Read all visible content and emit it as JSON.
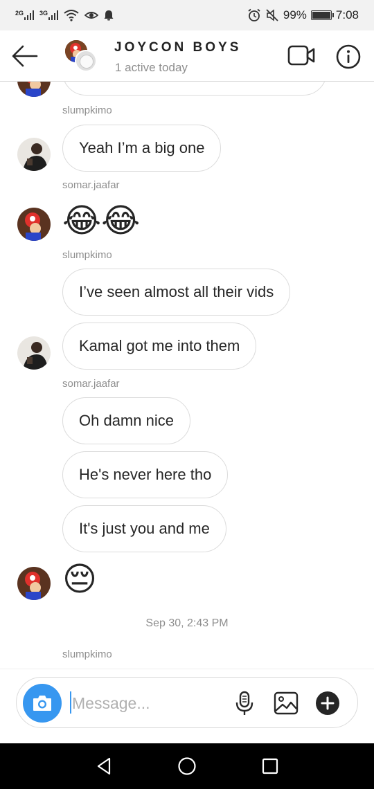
{
  "status_bar": {
    "network_1": "2G",
    "network_2": "3G",
    "battery_text": "99%",
    "battery_level": 0.99,
    "time": "7:08",
    "icons": [
      "signal-icon",
      "wifi-icon",
      "eye-icon",
      "notification-icon",
      "alarm-icon",
      "mute-icon",
      "battery-icon"
    ]
  },
  "header": {
    "title": "JOYCON BOYS",
    "subtitle": "1 active today",
    "icons": [
      "back-arrow-icon",
      "video-call-icon",
      "info-icon"
    ]
  },
  "messages": [
    {
      "type": "username",
      "text": "slumpkimo"
    },
    {
      "type": "text",
      "text": "Yeah I’m a big one"
    },
    {
      "type": "username",
      "text": "somar.jaafar"
    },
    {
      "type": "emoji",
      "text": "😂😂"
    },
    {
      "type": "username",
      "text": "slumpkimo"
    },
    {
      "type": "text",
      "text": "I’ve seen almost all their vids"
    },
    {
      "type": "text",
      "text": "Kamal got me into them"
    },
    {
      "type": "username",
      "text": "somar.jaafar"
    },
    {
      "type": "text",
      "text": "Oh damn nice"
    },
    {
      "type": "text",
      "text": "He's never here tho"
    },
    {
      "type": "text",
      "text": "It's just you and me"
    },
    {
      "type": "emoji",
      "text": "😔"
    },
    {
      "type": "timestamp",
      "text": "Sep 30, 2:43 PM"
    },
    {
      "type": "username",
      "text": "slumpkimo"
    }
  ],
  "composer": {
    "placeholder": "Message...",
    "value": "",
    "icons": [
      "camera-icon",
      "microphone-icon",
      "gallery-icon",
      "add-icon"
    ]
  },
  "colors": {
    "accent": "#3797f0",
    "bubble_border": "#dbdbdb",
    "secondary_text": "#8e8e8e"
  }
}
